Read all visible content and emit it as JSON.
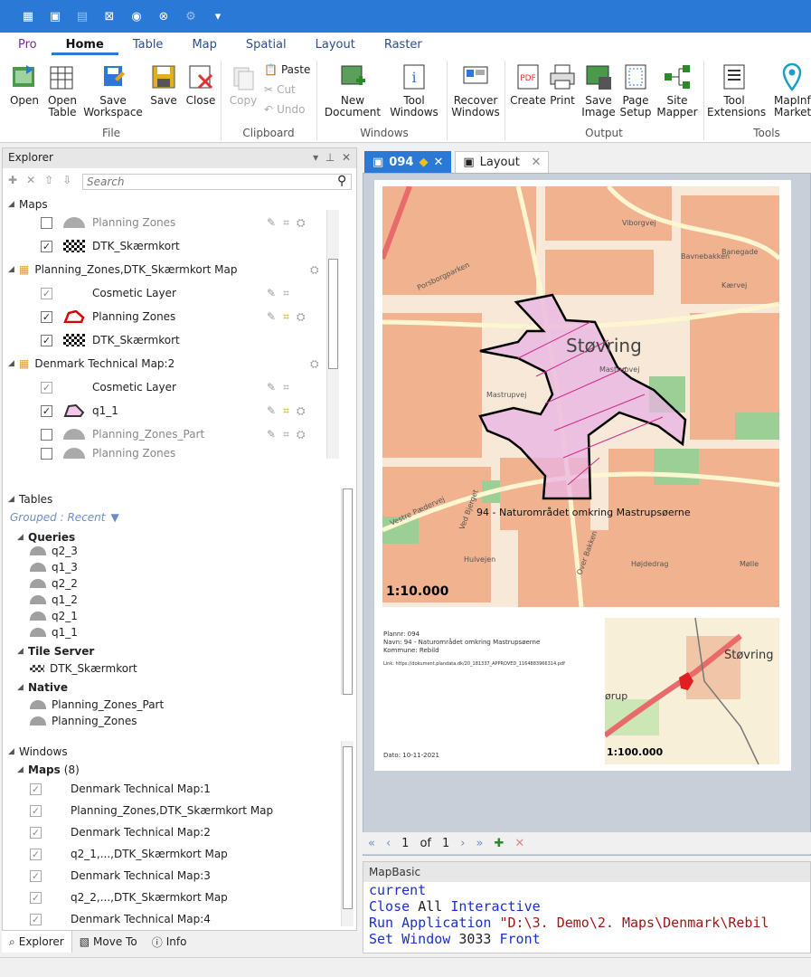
{
  "ribbon_tabs": [
    "Pro",
    "Home",
    "Table",
    "Map",
    "Spatial",
    "Layout",
    "Raster"
  ],
  "ribbon": {
    "file": {
      "open": "Open",
      "open_table": "Open Table",
      "save_workspace": "Save Workspace",
      "save": "Save",
      "close": "Close",
      "group": "File"
    },
    "clipboard": {
      "copy": "Copy",
      "paste": "Paste",
      "cut": "Cut",
      "undo": "Undo",
      "group": "Clipboard"
    },
    "windows": {
      "new_document": "New Document",
      "tool_windows": "Tool Windows",
      "recover": "Recover Windows",
      "group": "Windows"
    },
    "output": {
      "create": "Create",
      "print": "Print",
      "save_image": "Save Image",
      "page_setup": "Page Setup",
      "site_mapper": "Site Mapper",
      "group": "Output"
    },
    "tools": {
      "extensions": "Tool Extensions",
      "marketplace": "MapInfo Marketplace",
      "group": "Tools"
    }
  },
  "explorer": {
    "title": "Explorer",
    "search_placeholder": "Search",
    "maps_header": "Maps",
    "map_rows": [
      {
        "name": "Planning Zones",
        "checked": false,
        "dim": true
      },
      {
        "name": "DTK_Skærmkort",
        "checked": true
      }
    ],
    "map2": "Planning_Zones,DTK_Skærmkort Map",
    "map2_rows": [
      {
        "name": "Cosmetic Layer",
        "checked": true,
        "dim": true
      },
      {
        "name": "Planning Zones",
        "checked": true
      },
      {
        "name": "DTK_Skærmkort",
        "checked": true
      }
    ],
    "map3": "Denmark Technical Map:2",
    "map3_rows": [
      {
        "name": "Cosmetic Layer",
        "checked": true,
        "dim": true
      },
      {
        "name": "q1_1",
        "checked": true
      },
      {
        "name": "Planning_Zones_Part",
        "checked": false,
        "dim": true
      },
      {
        "name": "Planning Zones",
        "checked": false,
        "dim": true
      }
    ],
    "tables_header": "Tables",
    "grouped": "Grouped : Recent",
    "queries_header": "Queries",
    "queries": [
      "q2_3",
      "q1_3",
      "q2_2",
      "q1_2",
      "q2_1",
      "q1_1"
    ],
    "tile_header": "Tile Server",
    "tile_items": [
      "DTK_Skærmkort"
    ],
    "native_header": "Native",
    "native_items": [
      "Planning_Zones_Part",
      "Planning_Zones"
    ],
    "windows_header": "Windows",
    "windows_maps": "Maps",
    "windows_count": "(8)",
    "windows_items": [
      "Denmark Technical Map:1",
      "Planning_Zones,DTK_Skærmkort Map",
      "Denmark Technical Map:2",
      "q2_1,...,DTK_Skærmkort Map",
      "Denmark Technical Map:3",
      "q2_2,...,DTK_Skærmkort Map",
      "Denmark Technical Map:4"
    ]
  },
  "bottom_tabs": [
    "Explorer",
    "Move To",
    "Info"
  ],
  "doc_tabs": [
    "094",
    "Layout"
  ],
  "layout": {
    "town": "Støvring",
    "zone_label": "94 - Naturområdet omkring Mastrupsøerne",
    "scale_main": "1:10.000",
    "scale_inset": "1:100.000",
    "inset_town": "Støvring",
    "inset_orup": "ørup",
    "info_lines": [
      "Plannr: 094",
      "Navn: 94 - Naturområdet omkring Mastrupsøerne",
      "Kommune: Rebild"
    ],
    "link": "Link: https://dokument.plandata.dk/20_181337_APPROVED_1164883966314.pdf",
    "date": "Dato: 10-11-2021",
    "streets": [
      "Viborgvej",
      "Banegade",
      "Bavnebakken",
      "Kærvej",
      "Porsborgparken",
      "Mastrupvej",
      "Mastrupvej",
      "Over Bakken",
      "Vestre Pædervej",
      "Ved Bjerget",
      "Hulvejen",
      "Højdedrag",
      "Mølle"
    ]
  },
  "nav": {
    "page": "1",
    "of": "of",
    "total": "1"
  },
  "mapbasic": {
    "title": "MapBasic",
    "lines": [
      [
        {
          "t": "current",
          "c": "kw"
        }
      ],
      [
        {
          "t": "Close ",
          "c": "kw"
        },
        {
          "t": "All ",
          "c": ""
        },
        {
          "t": "Interactive",
          "c": "kw"
        }
      ],
      [
        {
          "t": "Run Application ",
          "c": "kw"
        },
        {
          "t": "\"D:\\3. Demo\\2. Maps\\Denmark\\Rebil",
          "c": "str"
        }
      ],
      [
        {
          "t": "Set Window ",
          "c": "kw"
        },
        {
          "t": "3033 ",
          "c": ""
        },
        {
          "t": "Front",
          "c": "kw"
        }
      ]
    ]
  }
}
